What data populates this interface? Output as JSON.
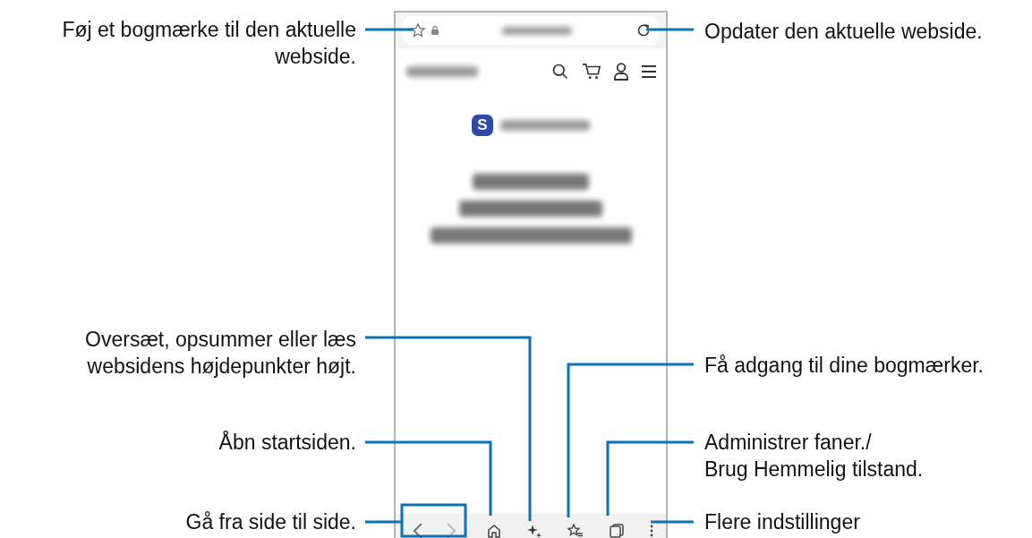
{
  "phone_screen": {
    "app_icon_letter": "S"
  },
  "left_callouts": [
    {
      "text": "Føj et bogmærke til den aktuelle\nwebside."
    },
    {
      "text": "Oversæt, opsummer eller læs\nwebsidens højdepunkter højt."
    },
    {
      "text": "Åbn startsiden."
    },
    {
      "text": "Gå fra side til side."
    }
  ],
  "right_callouts": [
    {
      "text": "Opdater den aktuelle webside."
    },
    {
      "text": "Få adgang til dine bogmærker."
    },
    {
      "text": "Administrer faner./\nBrug Hemmelig tilstand."
    },
    {
      "text": "Flere indstillinger"
    }
  ]
}
